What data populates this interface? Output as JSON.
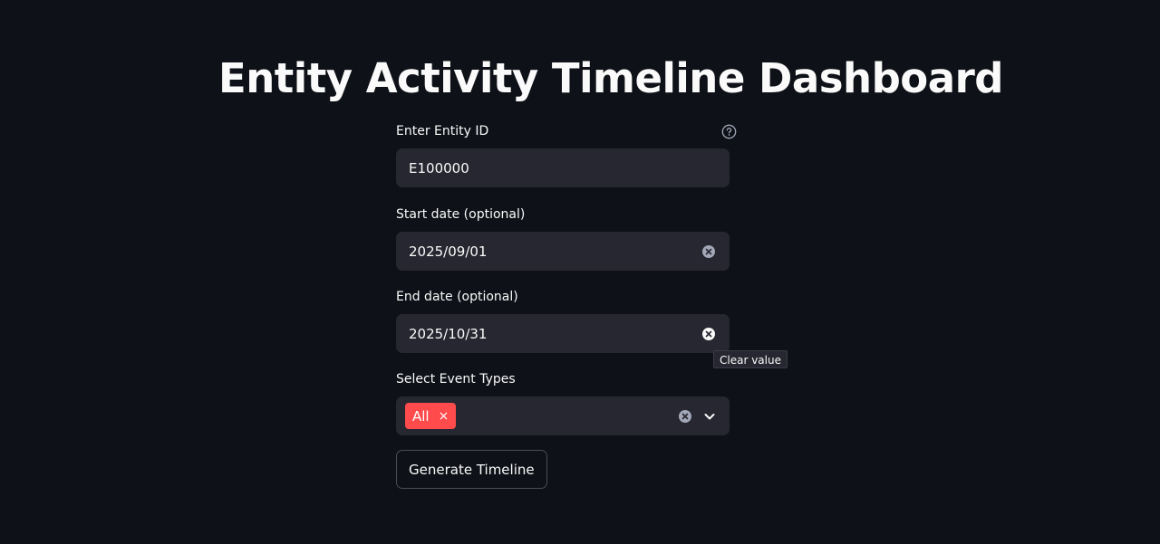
{
  "page": {
    "title": "Entity Activity Timeline Dashboard"
  },
  "form": {
    "entity": {
      "label": "Enter Entity ID",
      "value": "E100000",
      "help_icon": "question-circle-icon"
    },
    "start_date": {
      "label": "Start date (optional)",
      "value": "2025/09/01",
      "clear_icon": "clear-circle-icon"
    },
    "end_date": {
      "label": "End date (optional)",
      "value": "2025/10/31",
      "clear_icon": "clear-circle-icon"
    },
    "event_types": {
      "label": "Select Event Types",
      "selected": [
        "All"
      ],
      "tag_remove": "×",
      "clear_icon": "clear-circle-icon",
      "dropdown_icon": "chevron-down-icon"
    },
    "submit_label": "Generate Timeline"
  },
  "tooltip": {
    "text": "Clear value"
  },
  "colors": {
    "background": "#0e1117",
    "input_background": "#262730",
    "accent": "#ff4b4b",
    "text": "#fafafa"
  }
}
